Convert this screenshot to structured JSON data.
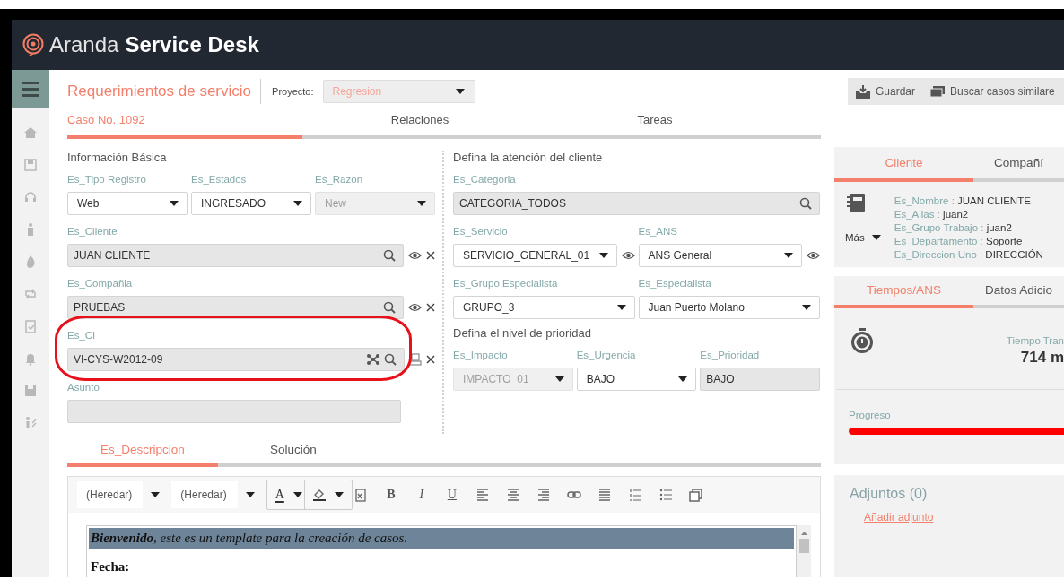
{
  "header": {
    "brand": "Aranda",
    "product": "Service Desk"
  },
  "page": {
    "title": "Requerimientos de servicio",
    "project": {
      "label": "Proyecto:",
      "value": "Regresion",
      "disabled": true
    }
  },
  "actions": [
    {
      "label": "Guardar",
      "kind": "save"
    },
    {
      "label": "Buscar casos similare",
      "kind": "similar"
    }
  ],
  "case_tabs": [
    {
      "label": "Caso No. 1092",
      "selected": true
    },
    {
      "label": "Relaciones",
      "selected": false
    },
    {
      "label": "Tareas",
      "selected": false
    }
  ],
  "basic_info": {
    "title": "Información Básica",
    "rows": [
      [
        {
          "label": "Es_Tipo Registro",
          "value": "Web",
          "kind": "select",
          "disabled": false
        },
        {
          "label": "Es_Estados",
          "value": "INGRESADO",
          "kind": "select",
          "disabled": false
        },
        {
          "label": "Es_Razon",
          "value": "New",
          "kind": "select",
          "disabled": true
        }
      ],
      [
        {
          "label": "Es_Cliente",
          "value": "JUAN CLIENTE",
          "kind": "lookup",
          "disabled": false,
          "viewable": true,
          "removable": true
        }
      ],
      [
        {
          "label": "Es_Compañia",
          "value": "PRUEBAS",
          "kind": "lookup",
          "disabled": false,
          "viewable": true,
          "removable": true
        }
      ],
      [
        {
          "label": "Es_CI",
          "value": "VI-CYS-W2012-09",
          "kind": "ci-lookup",
          "disabled": false,
          "removable": true,
          "highlighted": true
        }
      ],
      [
        {
          "label": "Asunto",
          "kind": "text",
          "disabled": false
        }
      ]
    ]
  },
  "attention": {
    "title": "Defina la atención del cliente",
    "rows": [
      [
        {
          "label": "Es_Categoria",
          "value": "CATEGORIA_TODOS",
          "kind": "lookup",
          "disabled": false
        }
      ],
      [
        {
          "label": "Es_Servicio",
          "value": "SERVICIO_GENERAL_01",
          "kind": "select",
          "disabled": false,
          "viewable": true
        },
        {
          "label": "Es_ANS",
          "value": "ANS General",
          "kind": "select",
          "disabled": false,
          "viewable": true
        }
      ],
      [
        {
          "label": "Es_Grupo Especialista",
          "value": "GRUPO_3",
          "kind": "select",
          "disabled": false
        },
        {
          "label": "Es_Especialista",
          "value": "Juan Puerto Molano",
          "kind": "select",
          "disabled": false
        }
      ]
    ]
  },
  "priority": {
    "title": "Defina el nivel de prioridad",
    "rows": [
      [
        {
          "label": "Es_Impacto",
          "value": "IMPACTO_01",
          "kind": "select",
          "disabled": true
        },
        {
          "label": "Es_Urgencia",
          "value": "BAJO",
          "kind": "select",
          "disabled": false
        },
        {
          "label": "Es_Prioridad",
          "value": "BAJO",
          "kind": "readonly",
          "disabled": false
        }
      ]
    ]
  },
  "description": {
    "tabs": [
      {
        "label": "Es_Descripcion",
        "selected": true
      },
      {
        "label": "Solución",
        "selected": false
      }
    ],
    "toolbar": [
      {
        "kind": "dropdown",
        "label": "(Heredar)"
      },
      {
        "kind": "dropdown",
        "label": "(Heredar)"
      },
      {
        "kind": "text-color",
        "label": "A"
      },
      {
        "kind": "highlight"
      },
      {
        "kind": "paste"
      },
      {
        "kind": "bold",
        "label": "B"
      },
      {
        "kind": "italic",
        "label": "I"
      },
      {
        "kind": "underline",
        "label": "U"
      },
      {
        "kind": "align-left"
      },
      {
        "kind": "align-center"
      },
      {
        "kind": "align-right"
      },
      {
        "kind": "link"
      },
      {
        "kind": "justify"
      },
      {
        "kind": "ordered-list"
      },
      {
        "kind": "bullet-list"
      },
      {
        "kind": "copy"
      }
    ],
    "lines": [
      {
        "kind": "banner",
        "text": "**Bienvenido**, este es un template para la creación de casos."
      },
      {
        "kind": "heading",
        "text": "Fecha:"
      }
    ]
  },
  "client_panel": {
    "tabs": [
      {
        "label": "Cliente",
        "selected": true
      },
      {
        "label": "Compañí",
        "selected": false
      }
    ],
    "more": "Más",
    "details": [
      {
        "label": "Es_Nombre :",
        "value": "JUAN CLIENTE"
      },
      {
        "label": "Es_Alias :",
        "value": "juan2"
      },
      {
        "label": "Es_Grupo Trabajo :",
        "value": "juan2"
      },
      {
        "label": "Es_Departamento :",
        "value": "Soporte"
      },
      {
        "label": "Es_Direccion Uno :",
        "value": "DIRECCIÓN"
      }
    ]
  },
  "sla_panel": {
    "tabs": [
      {
        "label": "Tiempos/ANS",
        "selected": true
      },
      {
        "label": "Datos Adicio",
        "selected": false
      }
    ],
    "timer_label": "Tiempo Tran",
    "timer_value": "714 m",
    "progress": {
      "label": "Progreso",
      "level": 1
    }
  },
  "attachments": {
    "title": "Adjuntos (0)",
    "link": "Añadir adjunto"
  }
}
